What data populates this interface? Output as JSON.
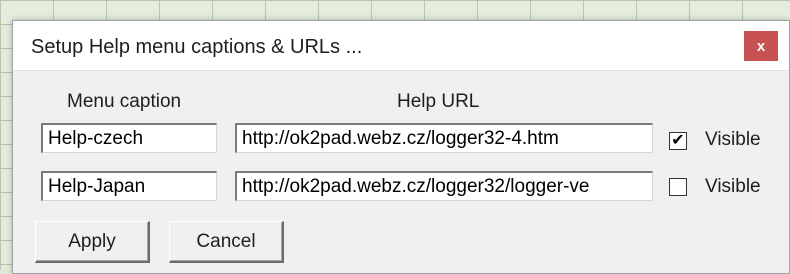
{
  "dialog": {
    "title": "Setup Help menu captions & URLs ...",
    "close_label": "x"
  },
  "columns": {
    "caption_header": "Menu caption",
    "url_header": "Help URL"
  },
  "rows": [
    {
      "caption": "Help-czech",
      "url": "http://ok2pad.webz.cz/logger32-4.htm",
      "checked_mark": "✔",
      "visible_label": "Visible"
    },
    {
      "caption": "Help-Japan",
      "url": "http://ok2pad.webz.cz/logger32/logger-ve",
      "checked_mark": "",
      "visible_label": "Visible"
    }
  ],
  "buttons": {
    "apply": "Apply",
    "cancel": "Cancel"
  },
  "colors": {
    "close_button": "#c75050",
    "dialog_bg": "#f0f0f0"
  }
}
